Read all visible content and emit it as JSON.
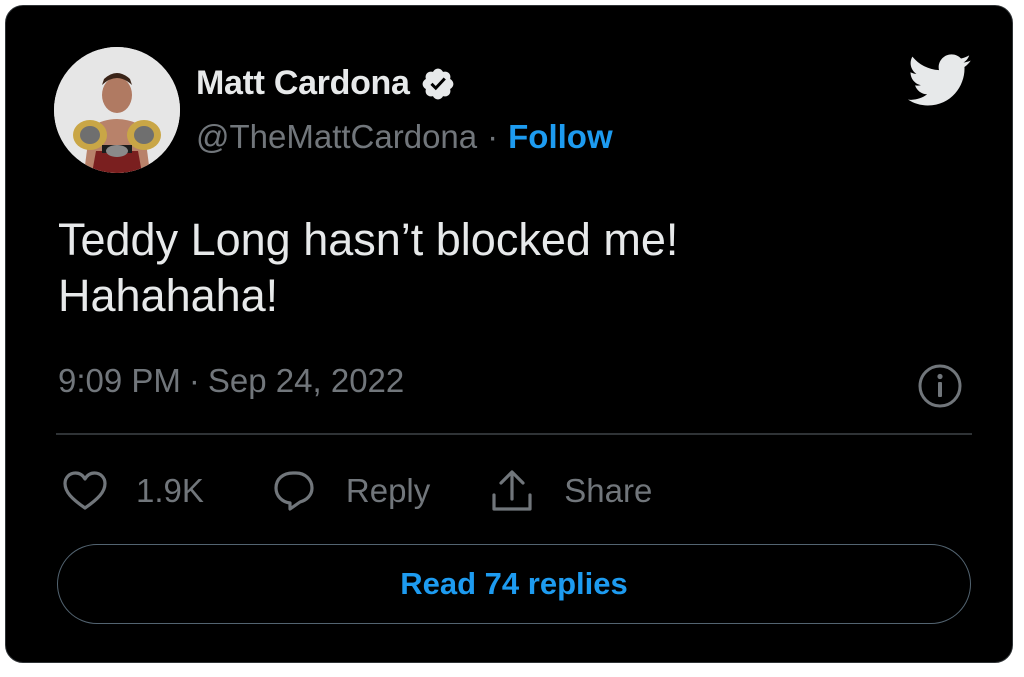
{
  "author": {
    "display_name": "Matt Cardona",
    "handle": "@TheMattCardona",
    "separator": "·",
    "follow_label": "Follow",
    "verified": true
  },
  "tweet": {
    "lines": [
      "Teddy Long hasn’t blocked me!",
      "Hahahaha!"
    ],
    "time": "9:09 PM",
    "time_separator": "·",
    "date": "Sep 24, 2022"
  },
  "actions": {
    "likes_count": "1.9K",
    "reply_label": "Reply",
    "share_label": "Share"
  },
  "read_replies_label": "Read 74 replies",
  "icons": {
    "brand": "twitter-bird-icon",
    "verified": "verified-badge-icon",
    "info": "info-icon",
    "like": "heart-icon",
    "reply": "speech-bubble-icon",
    "share": "share-icon"
  },
  "colors": {
    "background": "#000000",
    "text_primary": "#e7e9ea",
    "text_secondary": "#71767b",
    "accent": "#1d9bf0"
  }
}
